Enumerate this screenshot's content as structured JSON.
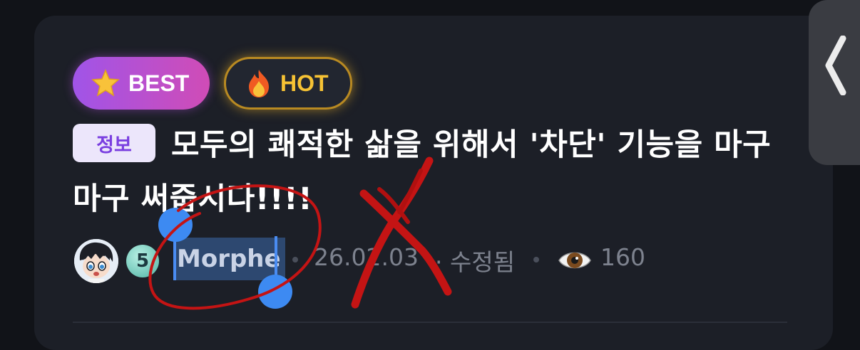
{
  "badges": {
    "best": {
      "label": "BEST",
      "icon": "star-icon"
    },
    "hot": {
      "label": "HOT",
      "icon": "fire-icon"
    }
  },
  "post": {
    "category": "정보",
    "title": "모두의 쾌적한 삶을 위해서 '차단' 기능을 마구마구 써줍시다!!!!"
  },
  "author": {
    "level": "5",
    "name": "Morphe"
  },
  "meta": {
    "date": "26.02.03",
    "edited": "· 수정됨",
    "views": "160"
  },
  "colors": {
    "background": "#111318",
    "card": "#1c1f27",
    "best_gradient_start": "#a054e8",
    "best_gradient_end": "#d04cb6",
    "hot_accent": "#f6c234",
    "selection": "#2d4870",
    "selection_handle": "#3d8af2",
    "annotation_red": "#c41414"
  }
}
